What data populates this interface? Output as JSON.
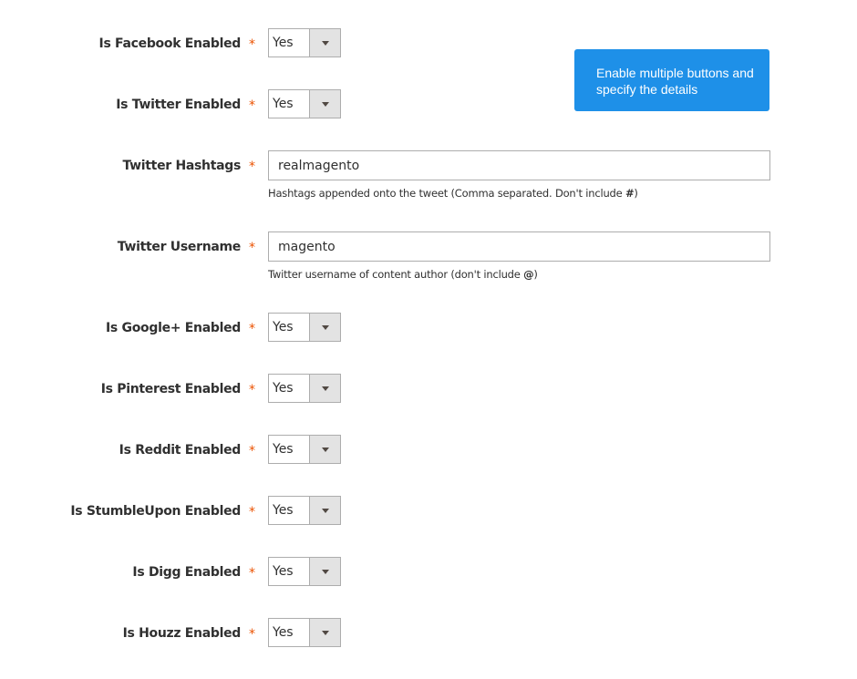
{
  "fields": [
    {
      "label": "Is Facebook Enabled",
      "type": "select",
      "value": "Yes",
      "required": true
    },
    {
      "label": "Is Twitter Enabled",
      "type": "select",
      "value": "Yes",
      "required": true
    },
    {
      "label": "Twitter Hashtags",
      "type": "text",
      "value": "realmagento",
      "required": true,
      "note_prefix": "Hashtags appended onto the tweet (Comma separated. Don't include ",
      "note_symbol": "#",
      "note_suffix": ")"
    },
    {
      "label": "Twitter Username",
      "type": "text",
      "value": "magento",
      "required": true,
      "note_prefix": "Twitter username of content author (don't include ",
      "note_symbol": "@",
      "note_suffix": ")"
    },
    {
      "label": "Is Google+ Enabled",
      "type": "select",
      "value": "Yes",
      "required": true
    },
    {
      "label": "Is Pinterest Enabled",
      "type": "select",
      "value": "Yes",
      "required": true
    },
    {
      "label": "Is Reddit Enabled",
      "type": "select",
      "value": "Yes",
      "required": true
    },
    {
      "label": "Is StumbleUpon Enabled",
      "type": "select",
      "value": "Yes",
      "required": true
    },
    {
      "label": "Is Digg Enabled",
      "type": "select",
      "value": "Yes",
      "required": true
    },
    {
      "label": "Is Houzz Enabled",
      "type": "select",
      "value": "Yes",
      "required": true
    }
  ],
  "required_marker": "*",
  "tooltip": {
    "text": "Enable multiple buttons and specify the details",
    "color": "#1e90e8"
  },
  "colors": {
    "required": "#eb5202",
    "select_button": "#e3e3e3",
    "border": "#adadad"
  }
}
